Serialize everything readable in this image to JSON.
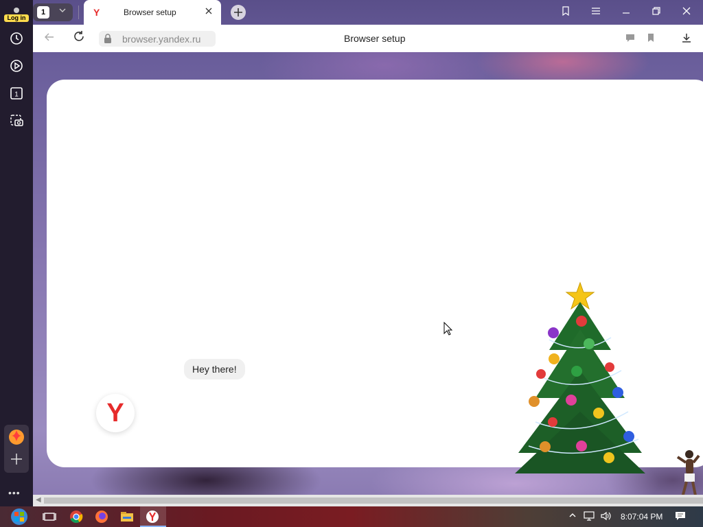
{
  "sidebar": {
    "login_label": "Log in",
    "items": [
      {
        "name": "history",
        "icon": "clock-icon"
      },
      {
        "name": "media",
        "icon": "play-icon"
      },
      {
        "name": "tabs",
        "icon": "tab-count-icon",
        "label": "1"
      },
      {
        "name": "screenshot",
        "icon": "camera-icon"
      }
    ],
    "bottom": [
      {
        "name": "zen",
        "icon": "zen-icon"
      },
      {
        "name": "add",
        "icon": "plus-icon"
      }
    ],
    "more_label": "•••"
  },
  "tabstrip": {
    "tab_count": "1",
    "active_tab": {
      "favicon": "Y",
      "title": "Browser setup"
    },
    "window_buttons": [
      "bookmarks-icon",
      "menu-icon",
      "minimize-icon",
      "restore-icon",
      "close-icon"
    ]
  },
  "addressbar": {
    "url": "browser.yandex.ru",
    "page_title": "Browser setup"
  },
  "content": {
    "greeting": "Hey there!",
    "logo_letter": "Y"
  },
  "taskbar": {
    "apps": [
      "task-view-icon",
      "chrome-icon",
      "firefox-icon",
      "explorer-icon",
      "yandex-icon"
    ],
    "active_app": "yandex-icon",
    "clock": "8:07:04 PM"
  },
  "colors": {
    "yandex_red": "#e62b2b",
    "login_badge": "#ffdb4d",
    "sidebar_bg": "#221c2e"
  }
}
